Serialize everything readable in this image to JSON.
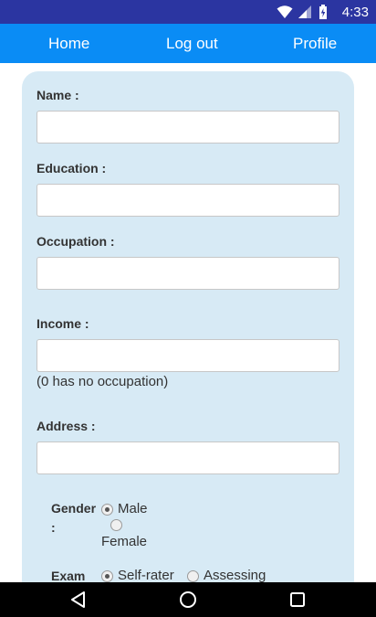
{
  "status_bar": {
    "time": "4:33",
    "icons": [
      "wifi-icon",
      "cell-signal-icon",
      "battery-icon"
    ]
  },
  "nav": {
    "home": "Home",
    "logout": "Log out",
    "profile": "Profile"
  },
  "form": {
    "name": {
      "label": "Name :",
      "value": ""
    },
    "education": {
      "label": "Education :",
      "value": ""
    },
    "occupation": {
      "label": "Occupation :",
      "value": ""
    },
    "income": {
      "label": "Income :",
      "value": "",
      "hint": "(0 has no occupation)"
    },
    "address": {
      "label": "Address :",
      "value": ""
    },
    "gender": {
      "label": "Gender :",
      "options": [
        {
          "label": "Male",
          "checked": true
        },
        {
          "label": "Female",
          "checked": false
        }
      ]
    },
    "exam": {
      "label": "Exam",
      "options": [
        {
          "label": "Self-rater",
          "checked": true
        },
        {
          "label": "Assessing",
          "checked": false
        }
      ]
    }
  },
  "system_nav": [
    "back-icon",
    "home-circle-icon",
    "recents-icon"
  ]
}
